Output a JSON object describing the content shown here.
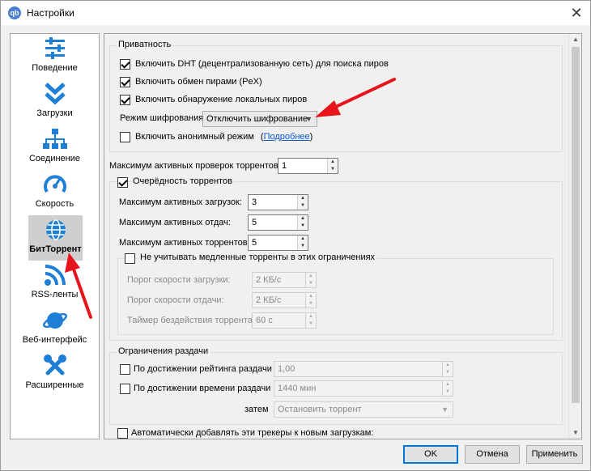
{
  "window": {
    "title": "Настройки",
    "app_icon_text": "qb",
    "close_glyph": "✕"
  },
  "sidebar": {
    "items": [
      {
        "label": "Поведение",
        "icon": "sliders-icon"
      },
      {
        "label": "Загрузки",
        "icon": "double-chevron-down-icon"
      },
      {
        "label": "Соединение",
        "icon": "network-icon"
      },
      {
        "label": "Скорость",
        "icon": "speedometer-icon"
      },
      {
        "label": "БитТоррент",
        "icon": "globe-icon",
        "selected": true
      },
      {
        "label": "RSS-ленты",
        "icon": "rss-icon"
      },
      {
        "label": "Веб-интерфейс",
        "icon": "planet-icon"
      },
      {
        "label": "Расширенные",
        "icon": "tools-icon"
      }
    ]
  },
  "privacy": {
    "title": "Приватность",
    "dht": {
      "label": "Включить DHT (децентрализованную сеть) для поиска пиров",
      "checked": true
    },
    "pex": {
      "label": "Включить обмен пирами (PeX)",
      "checked": true
    },
    "lpd": {
      "label": "Включить обнаружение локальных пиров",
      "checked": true
    },
    "encryption": {
      "label": "Режим шифрования:",
      "value": "Отключить шифрование"
    },
    "anonymous": {
      "label": "Включить анонимный режим",
      "checked": false,
      "link_open": "(",
      "link": "Подробнее",
      "link_close": ")"
    }
  },
  "max_checks": {
    "label": "Максимум активных проверок торрентов:",
    "value": "1"
  },
  "queue": {
    "label": "Очерёдность торрентов",
    "checked": true,
    "downloads": {
      "label": "Максимум активных загрузок:",
      "value": "3"
    },
    "uploads": {
      "label": "Максимум активных отдач:",
      "value": "5"
    },
    "torrents": {
      "label": "Максимум активных торрентов:",
      "value": "5"
    },
    "slow": {
      "label": "Не учитывать медленные торренты в этих ограничениях",
      "checked": false,
      "download_threshold": {
        "label": "Порог скорости загрузки:",
        "value": "2 КБ/с"
      },
      "upload_threshold": {
        "label": "Порог скорости отдачи:",
        "value": "2 КБ/с"
      },
      "inactivity_timer": {
        "label": "Таймер бездействия торрента:",
        "value": "60 с"
      }
    }
  },
  "seeding": {
    "title": "Ограничения раздачи",
    "ratio": {
      "label": "По достижении рейтинга раздачи",
      "checked": false,
      "value": "1,00"
    },
    "time": {
      "label": "По достижении времени раздачи",
      "checked": false,
      "value": "1440 мин"
    },
    "then": {
      "label": "затем",
      "value": "Остановить торрент"
    }
  },
  "trackers": {
    "label": "Автоматически добавлять эти трекеры к новым загрузкам:",
    "checked": false
  },
  "buttons": {
    "ok": "OK",
    "cancel": "Отмена",
    "apply": "Применить"
  },
  "colors": {
    "annotation_arrow": "#e8141c",
    "selection_border": "#0078d7",
    "link": "#0b57c9",
    "icon_blue": "#1e7fd6"
  }
}
